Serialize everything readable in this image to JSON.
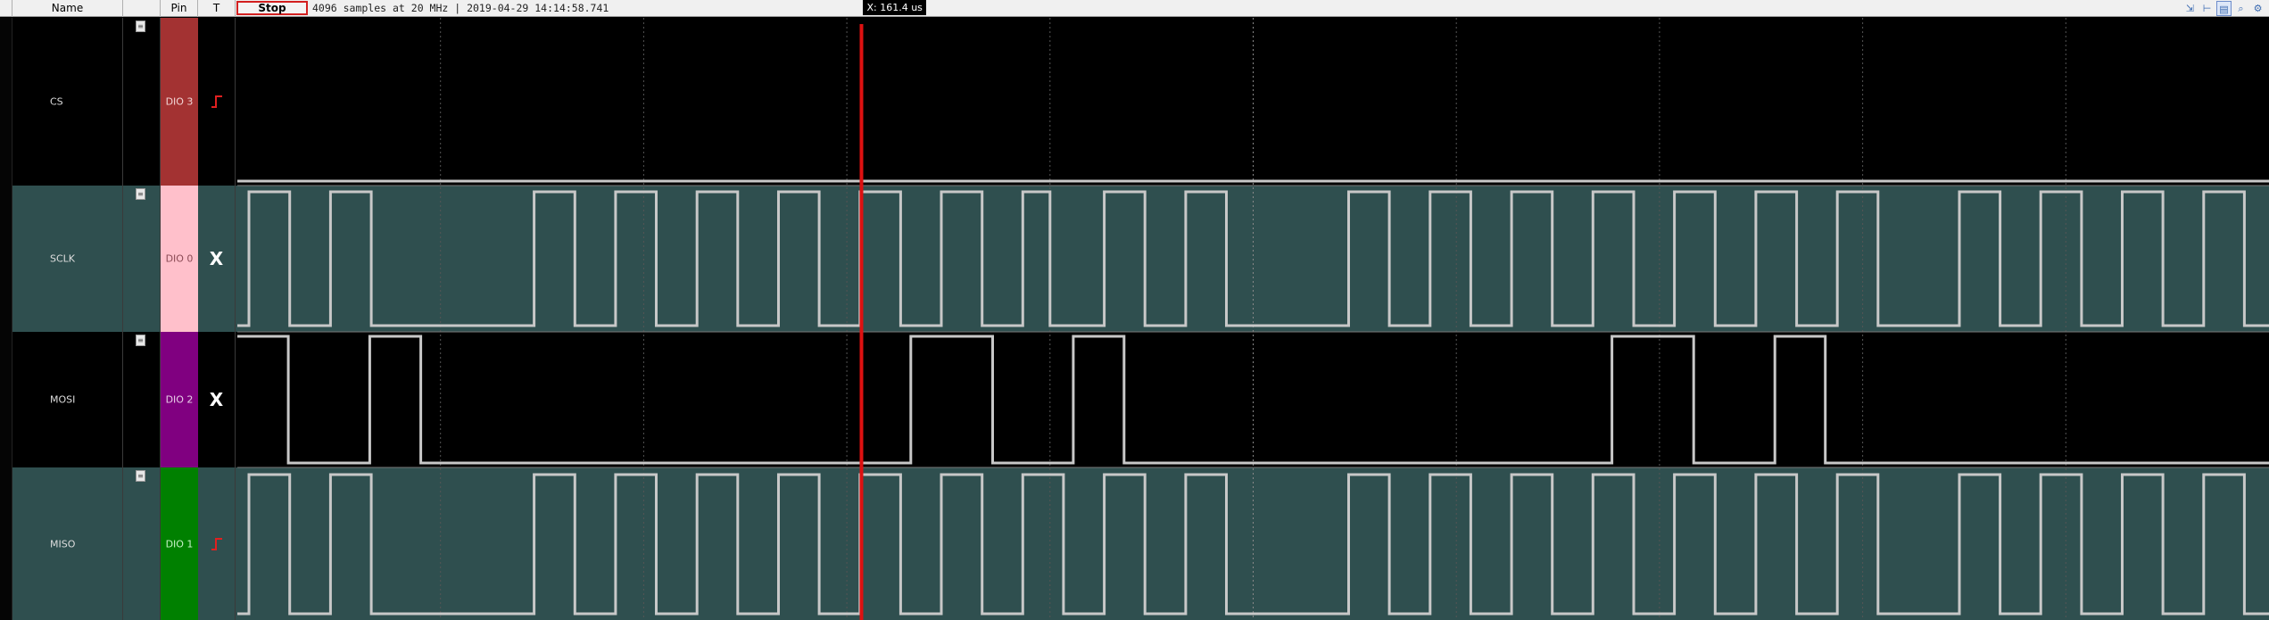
{
  "header": {
    "name_label": "Name",
    "pin_label": "Pin",
    "trigger_label": "T",
    "stop_label": "Stop",
    "status": "4096 samples at 20 MHz | 2019-04-29 14:14:58.741",
    "cursor_readout": "X: 161.4 us"
  },
  "toolbar": [
    "zoom-fit-icon",
    "zoom-width-icon",
    "data-view-icon",
    "zoom-icon",
    "zoom-settings-icon"
  ],
  "colors": {
    "accent_red": "#d32020",
    "dark_row_bg": "#000000",
    "teal_row_bg": "#2f4f4f",
    "trace": "#c8c8c8",
    "cursor": "#dd1111",
    "grid": "#555555"
  },
  "channels": [
    {
      "name": "CS",
      "pin": "DIO 3",
      "pin_bg": "#a33232",
      "pin_fg": "#f2d6d6",
      "trigger": "rising",
      "row_bg": "#000000",
      "waveform": [
        [
          0,
          0
        ],
        [
          1,
          0
        ]
      ]
    },
    {
      "name": "SCLK",
      "pin": "DIO 0",
      "pin_bg": "#ffc0cb",
      "pin_fg": "#8a4a55",
      "trigger": "X",
      "row_bg": "#2f4f4f",
      "waveform": [
        [
          0,
          0
        ],
        [
          0.00572,
          1
        ],
        [
          0.0258,
          0
        ],
        [
          0.04585,
          1
        ],
        [
          0.0659,
          0
        ],
        [
          0.14605,
          1
        ],
        [
          0.16613,
          0
        ],
        [
          0.18618,
          1
        ],
        [
          0.2062,
          0
        ],
        [
          0.22625,
          1
        ],
        [
          0.2463,
          0
        ],
        [
          0.26635,
          1
        ],
        [
          0.2864,
          0
        ],
        [
          0.30645,
          1
        ],
        [
          0.32648,
          0
        ],
        [
          0.34653,
          1
        ],
        [
          0.36658,
          0
        ],
        [
          0.3866,
          1
        ],
        [
          0.40665,
          0
        ],
        [
          0.4267,
          1
        ],
        [
          0.44675,
          0
        ],
        [
          0.46678,
          1
        ],
        [
          0.48683,
          0
        ],
        [
          0.45,
          0.0
        ],
        [
          0.5,
          0.0
        ],
        [
          0.45,
          0.0
        ],
        [
          0.5,
          0.0
        ],
        [
          0.54,
          0.0
        ],
        [
          0.4,
          0.0
        ],
        [
          0.547,
          1
        ],
        [
          0.567,
          0
        ],
        [
          0.5871,
          1
        ],
        [
          0.6071,
          0
        ],
        [
          0.6272,
          1
        ],
        [
          0.6472,
          0
        ],
        [
          0.66725,
          1
        ],
        [
          0.6873,
          0
        ],
        [
          0.70735,
          1
        ],
        [
          0.7274,
          0
        ],
        [
          0.74743,
          1
        ],
        [
          0.76748,
          0
        ],
        [
          0.78753,
          1
        ],
        [
          0.80755,
          0
        ],
        [
          0.8476,
          1
        ],
        [
          0.86763,
          0
        ],
        [
          0.88768,
          1
        ],
        [
          0.90773,
          0
        ],
        [
          0.92775,
          1
        ],
        [
          0.9478,
          0
        ],
        [
          0.96785,
          1
        ],
        [
          0.98788,
          0
        ],
        [
          1,
          0
        ]
      ]
    },
    {
      "name": "MOSI",
      "pin": "DIO 2",
      "pin_bg": "#800080",
      "pin_fg": "#e8cfe8",
      "trigger": "X",
      "row_bg": "#000000",
      "waveform": [
        [
          0,
          1
        ],
        [
          0.02508,
          0
        ],
        [
          0.06518,
          1
        ],
        [
          0.0903,
          0
        ],
        [
          0.3315,
          1
        ],
        [
          0.37175,
          0
        ],
        [
          0.41145,
          1
        ],
        [
          0.43645,
          0
        ],
        [
          0.6766,
          1
        ],
        [
          0.7168,
          0
        ],
        [
          0.7568,
          1
        ],
        [
          0.78158,
          0
        ],
        [
          1,
          0
        ]
      ]
    },
    {
      "name": "MISO",
      "pin": "DIO 1",
      "pin_bg": "#008000",
      "pin_fg": "#c7f0c7",
      "trigger": "rising",
      "row_bg": "#2f4f4f",
      "waveform": [
        [
          0,
          0
        ],
        [
          0.00572,
          1
        ],
        [
          0.0258,
          0
        ],
        [
          0.04585,
          1
        ],
        [
          0.0659,
          0
        ],
        [
          0.14605,
          1
        ],
        [
          0.16613,
          0
        ],
        [
          0.18618,
          1
        ],
        [
          0.2062,
          0
        ],
        [
          0.22625,
          1
        ],
        [
          0.2463,
          0
        ],
        [
          0.26635,
          1
        ],
        [
          0.2864,
          0
        ],
        [
          0.30645,
          1
        ],
        [
          0.32648,
          0
        ],
        [
          0.34653,
          1
        ],
        [
          0.36658,
          0
        ],
        [
          0.3866,
          1
        ],
        [
          0.40665,
          0
        ],
        [
          0.4267,
          1
        ],
        [
          0.44675,
          0
        ],
        [
          0.46678,
          1
        ],
        [
          0.48683,
          0
        ],
        [
          0.547,
          1
        ],
        [
          0.567,
          0
        ],
        [
          0.5871,
          1
        ],
        [
          0.6071,
          0
        ],
        [
          0.6272,
          1
        ],
        [
          0.6472,
          0
        ],
        [
          0.66725,
          1
        ],
        [
          0.6873,
          0
        ],
        [
          0.70735,
          1
        ],
        [
          0.7274,
          0
        ],
        [
          0.74743,
          1
        ],
        [
          0.76748,
          0
        ],
        [
          0.78753,
          1
        ],
        [
          0.80755,
          0
        ],
        [
          0.8476,
          1
        ],
        [
          0.86763,
          0
        ],
        [
          0.88768,
          1
        ],
        [
          0.90773,
          0
        ],
        [
          0.92775,
          1
        ],
        [
          0.9478,
          0
        ],
        [
          0.96785,
          1
        ],
        [
          0.98788,
          0
        ],
        [
          1,
          0
        ]
      ]
    }
  ],
  "cursor": {
    "position": 0.3072
  }
}
